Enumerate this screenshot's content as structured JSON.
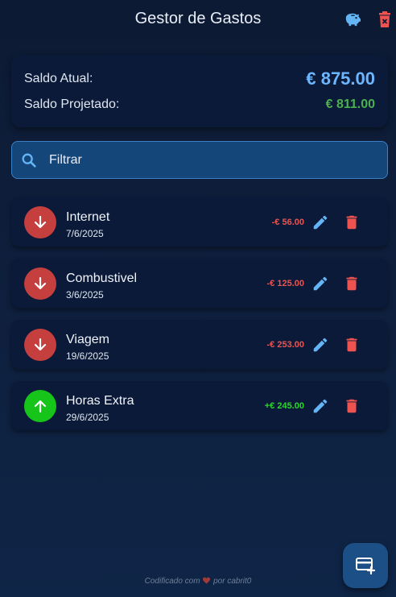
{
  "header": {
    "title": "Gestor de Gastos",
    "icons": {
      "left": "piggy-bank-icon",
      "right": "delete-icon"
    }
  },
  "balance": {
    "current_label": "Saldo Atual:",
    "current_value": "€ 875.00",
    "projected_label": "Saldo Projetado:",
    "projected_value": "€ 811.00",
    "colors": {
      "current": "#6cb6ff",
      "projected": "#4caf50"
    }
  },
  "filter": {
    "placeholder": "Filtrar",
    "value": "",
    "icon": "search-icon"
  },
  "transactions": [
    {
      "name": "Internet",
      "date": "7/6/2025",
      "amount": "-€ 56.00",
      "type": "expense"
    },
    {
      "name": "Combustivel",
      "date": "3/6/2025",
      "amount": "-€ 125.00",
      "type": "expense"
    },
    {
      "name": "Viagem",
      "date": "19/6/2025",
      "amount": "-€ 253.00",
      "type": "expense"
    },
    {
      "name": "Horas Extra",
      "date": "29/6/2025",
      "amount": "+€ 245.00",
      "type": "income"
    }
  ],
  "footer": {
    "prefix": "Codificado com",
    "suffix": "por cabrit0",
    "icon": "heart-icon"
  },
  "fab": {
    "icon": "add-card-icon"
  },
  "colors": {
    "expense": "#c63f3f",
    "income": "#16c41a",
    "accent": "#64b5f6",
    "danger": "#ef5350"
  }
}
